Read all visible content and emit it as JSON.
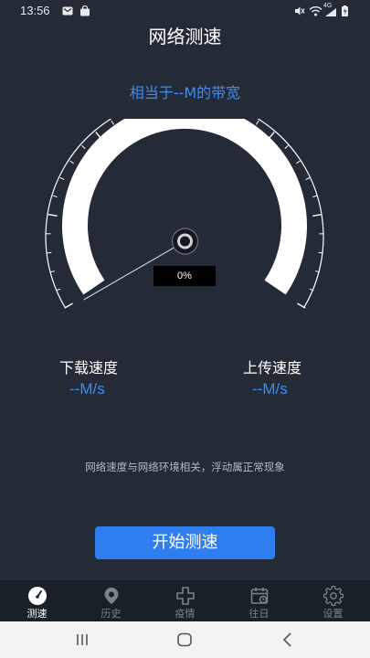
{
  "status_bar": {
    "time": "13:56",
    "left_icons": [
      "mail-icon",
      "bag-icon"
    ],
    "right_icons": [
      "mute-icon",
      "wifi-icon",
      "signal-4g-icon",
      "battery-icon"
    ],
    "network_label": "4G"
  },
  "header": {
    "title": "网络测速"
  },
  "bandwidth_text": "相当于--M的带宽",
  "gauge": {
    "percent_label": "0%",
    "progress": 0
  },
  "download": {
    "label": "下载速度",
    "value": "--M/s"
  },
  "upload": {
    "label": "上传速度",
    "value": "--M/s"
  },
  "note": "网络速度与网络环境相关，浮动属正常现象",
  "start_button": {
    "label": "开始测速"
  },
  "tabs": [
    {
      "label": "测速",
      "icon": "speedometer-icon",
      "active": true
    },
    {
      "label": "历史",
      "icon": "history-pin-icon",
      "active": false
    },
    {
      "label": "疫情",
      "icon": "medical-cross-icon",
      "active": false
    },
    {
      "label": "往日",
      "icon": "calendar-icon",
      "active": false
    },
    {
      "label": "设置",
      "icon": "gear-icon",
      "active": false
    }
  ],
  "colors": {
    "background": "#242b37",
    "accent": "#3c8cf2",
    "button": "#2f7ef0",
    "tabbar": "#192028"
  }
}
